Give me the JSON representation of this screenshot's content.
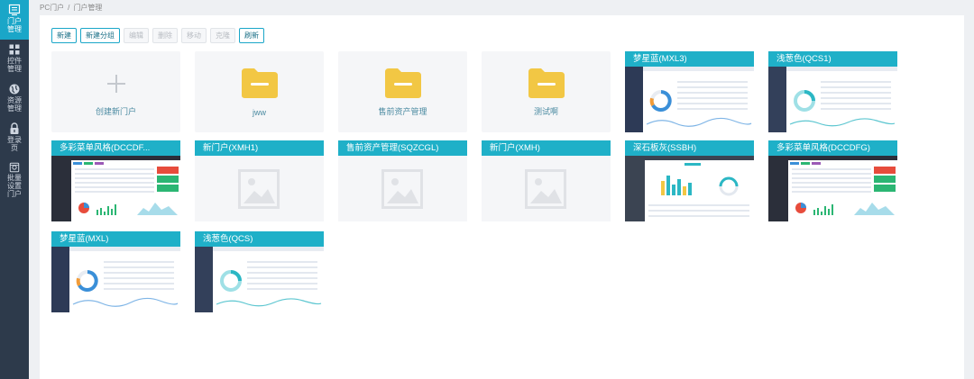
{
  "sidebar": {
    "items": [
      {
        "label": "门户管理",
        "icon": "portal-icon",
        "active": true
      },
      {
        "label": "控件管理",
        "icon": "widgets-icon",
        "active": false
      },
      {
        "label": "资源管理",
        "icon": "globe-icon",
        "active": false
      },
      {
        "label": "登录页",
        "icon": "lock-icon",
        "active": false
      },
      {
        "label": "批量设置门户",
        "icon": "batch-icon",
        "active": false
      }
    ]
  },
  "breadcrumb": {
    "root": "PC门户",
    "separator": "/",
    "current": "门户管理"
  },
  "toolbar": {
    "new": "新建",
    "new_group": "新建分组",
    "edit": "编辑",
    "delete": "删除",
    "move": "移动",
    "clone": "克隆",
    "refresh": "刷新"
  },
  "create_card": {
    "label": "创建新门户"
  },
  "folders": [
    {
      "name": "jww"
    },
    {
      "name": "售前资产管理"
    },
    {
      "name": "测试啊"
    }
  ],
  "templates": [
    {
      "title": "梦星蓝(MXL3)",
      "style": "mxl"
    },
    {
      "title": "浅葱色(QCS1)",
      "style": "qcs"
    },
    {
      "title": "多彩菜单风格(DCCDF...",
      "style": "dccd"
    },
    {
      "title": "新门户(XMH1)",
      "style": "empty"
    },
    {
      "title": "售前资产管理(SQZCGL)",
      "style": "empty"
    },
    {
      "title": "新门户(XMH)",
      "style": "empty"
    },
    {
      "title": "深石板灰(SSBH)",
      "style": "ssbh"
    },
    {
      "title": "多彩菜单风格(DCCDFG)",
      "style": "dccd"
    },
    {
      "title": "梦星蓝(MXL)",
      "style": "mxl"
    },
    {
      "title": "浅葱色(QCS)",
      "style": "qcs"
    }
  ],
  "colors": {
    "accent": "#1aa6c8",
    "sidebar": "#2d3a4b",
    "folder": "#f2c744",
    "card_title": "#1fb0c8"
  }
}
